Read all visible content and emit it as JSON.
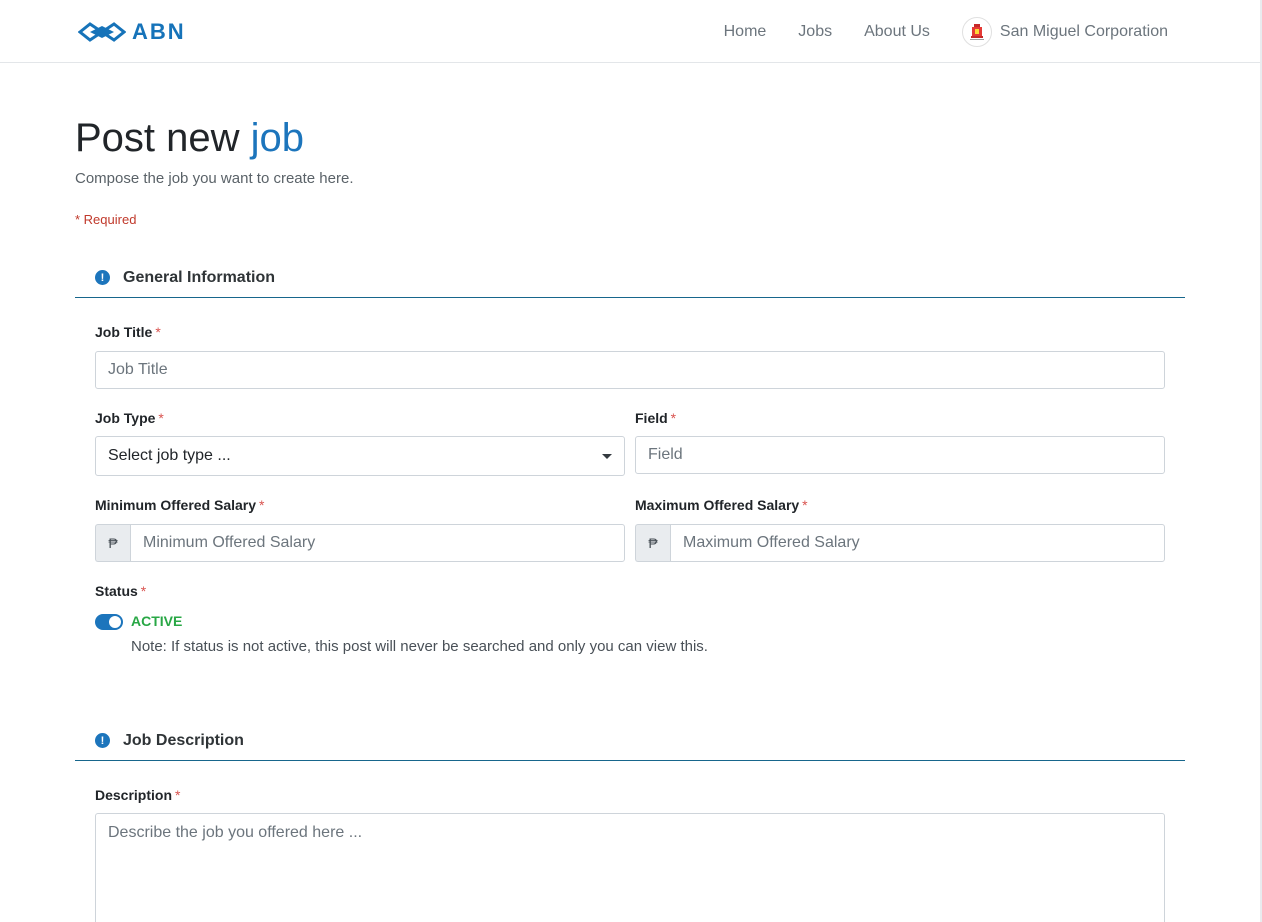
{
  "navbar": {
    "logo_text": "ABN",
    "links": [
      "Home",
      "Jobs",
      "About Us"
    ],
    "company_name": "San Miguel Corporation"
  },
  "page": {
    "title_main": "Post new ",
    "title_accent": "job",
    "subtitle": "Compose the job you want to create here.",
    "required_note": "* Required"
  },
  "general_section": {
    "title": "General Information",
    "icon": "exclamation-circle-icon"
  },
  "fields": {
    "job_title": {
      "label": "Job Title",
      "placeholder": "Job Title",
      "value": ""
    },
    "job_type": {
      "label": "Job Type",
      "selected": "Select job type ..."
    },
    "field": {
      "label": "Field",
      "placeholder": "Field",
      "value": ""
    },
    "min_salary": {
      "label": "Minimum Offered Salary",
      "prefix": "₱",
      "placeholder": "Minimum Offered Salary",
      "value": ""
    },
    "max_salary": {
      "label": "Maximum Offered Salary",
      "prefix": "₱",
      "placeholder": "Maximum Offered Salary",
      "value": ""
    },
    "status": {
      "label": "Status",
      "value": "ACTIVE",
      "enabled": true,
      "note": "Note: If status is not active, this post will never be searched and only you can view this."
    }
  },
  "description_section": {
    "title": "Job Description",
    "icon": "exclamation-circle-icon"
  },
  "description": {
    "label": "Description",
    "placeholder": "Describe the job you offered here ..."
  },
  "required_star": "*",
  "colors": {
    "brand": "#1c75bc",
    "required": "#d9534f",
    "active": "#28a745",
    "section_rule": "#17668c"
  }
}
